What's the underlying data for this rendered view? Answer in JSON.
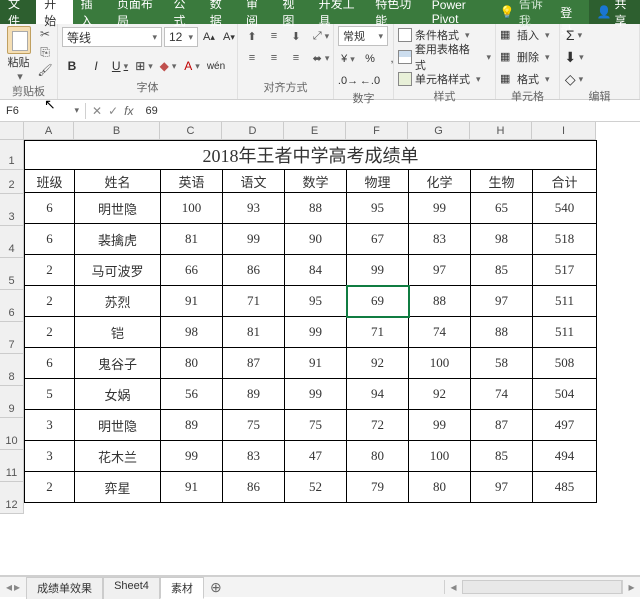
{
  "menu": {
    "file": "文件",
    "tabs": [
      "开始",
      "插入",
      "页面布局",
      "公式",
      "数据",
      "审阅",
      "视图",
      "开发工具",
      "特色功能",
      "Power Pivot"
    ],
    "tellme": "告诉我",
    "login": "登录",
    "share": "共享"
  },
  "ribbon": {
    "clipboard": {
      "paste": "粘贴",
      "label": "剪贴板"
    },
    "font": {
      "name": "等线",
      "size": "12",
      "label": "字体"
    },
    "align": {
      "label": "对齐方式"
    },
    "number": {
      "format": "常规",
      "label": "数字"
    },
    "styles": {
      "cond": "条件格式",
      "table": "套用表格格式",
      "cell": "单元格样式",
      "label": "样式"
    },
    "cells": {
      "insert": "插入",
      "delete": "删除",
      "format": "格式",
      "label": "单元格"
    },
    "editing": {
      "label": "编辑"
    }
  },
  "namebox": "F6",
  "fxvalue": "69",
  "colLetters": [
    "A",
    "B",
    "C",
    "D",
    "E",
    "F",
    "G",
    "H",
    "I"
  ],
  "title": "2018年王者中学高考成绩单",
  "headers": [
    "班级",
    "姓名",
    "英语",
    "语文",
    "数学",
    "物理",
    "化学",
    "生物",
    "合计"
  ],
  "rows": [
    [
      "6",
      "明世隐",
      "100",
      "93",
      "88",
      "95",
      "99",
      "65",
      "540"
    ],
    [
      "6",
      "裴擒虎",
      "81",
      "99",
      "90",
      "67",
      "83",
      "98",
      "518"
    ],
    [
      "2",
      "马可波罗",
      "66",
      "86",
      "84",
      "99",
      "97",
      "85",
      "517"
    ],
    [
      "2",
      "苏烈",
      "91",
      "71",
      "95",
      "69",
      "88",
      "97",
      "511"
    ],
    [
      "2",
      "铠",
      "98",
      "81",
      "99",
      "71",
      "74",
      "88",
      "511"
    ],
    [
      "6",
      "鬼谷子",
      "80",
      "87",
      "91",
      "92",
      "100",
      "58",
      "508"
    ],
    [
      "5",
      "女娲",
      "56",
      "89",
      "99",
      "94",
      "92",
      "74",
      "504"
    ],
    [
      "3",
      "明世隐",
      "89",
      "75",
      "75",
      "72",
      "99",
      "87",
      "497"
    ],
    [
      "3",
      "花木兰",
      "99",
      "83",
      "47",
      "80",
      "100",
      "85",
      "494"
    ],
    [
      "2",
      "弈星",
      "91",
      "86",
      "52",
      "79",
      "80",
      "97",
      "485"
    ]
  ],
  "selectedCell": {
    "row": 3,
    "col": 5
  },
  "sheets": {
    "list": [
      "成绩单效果",
      "Sheet4",
      "素材"
    ],
    "active": 2
  }
}
